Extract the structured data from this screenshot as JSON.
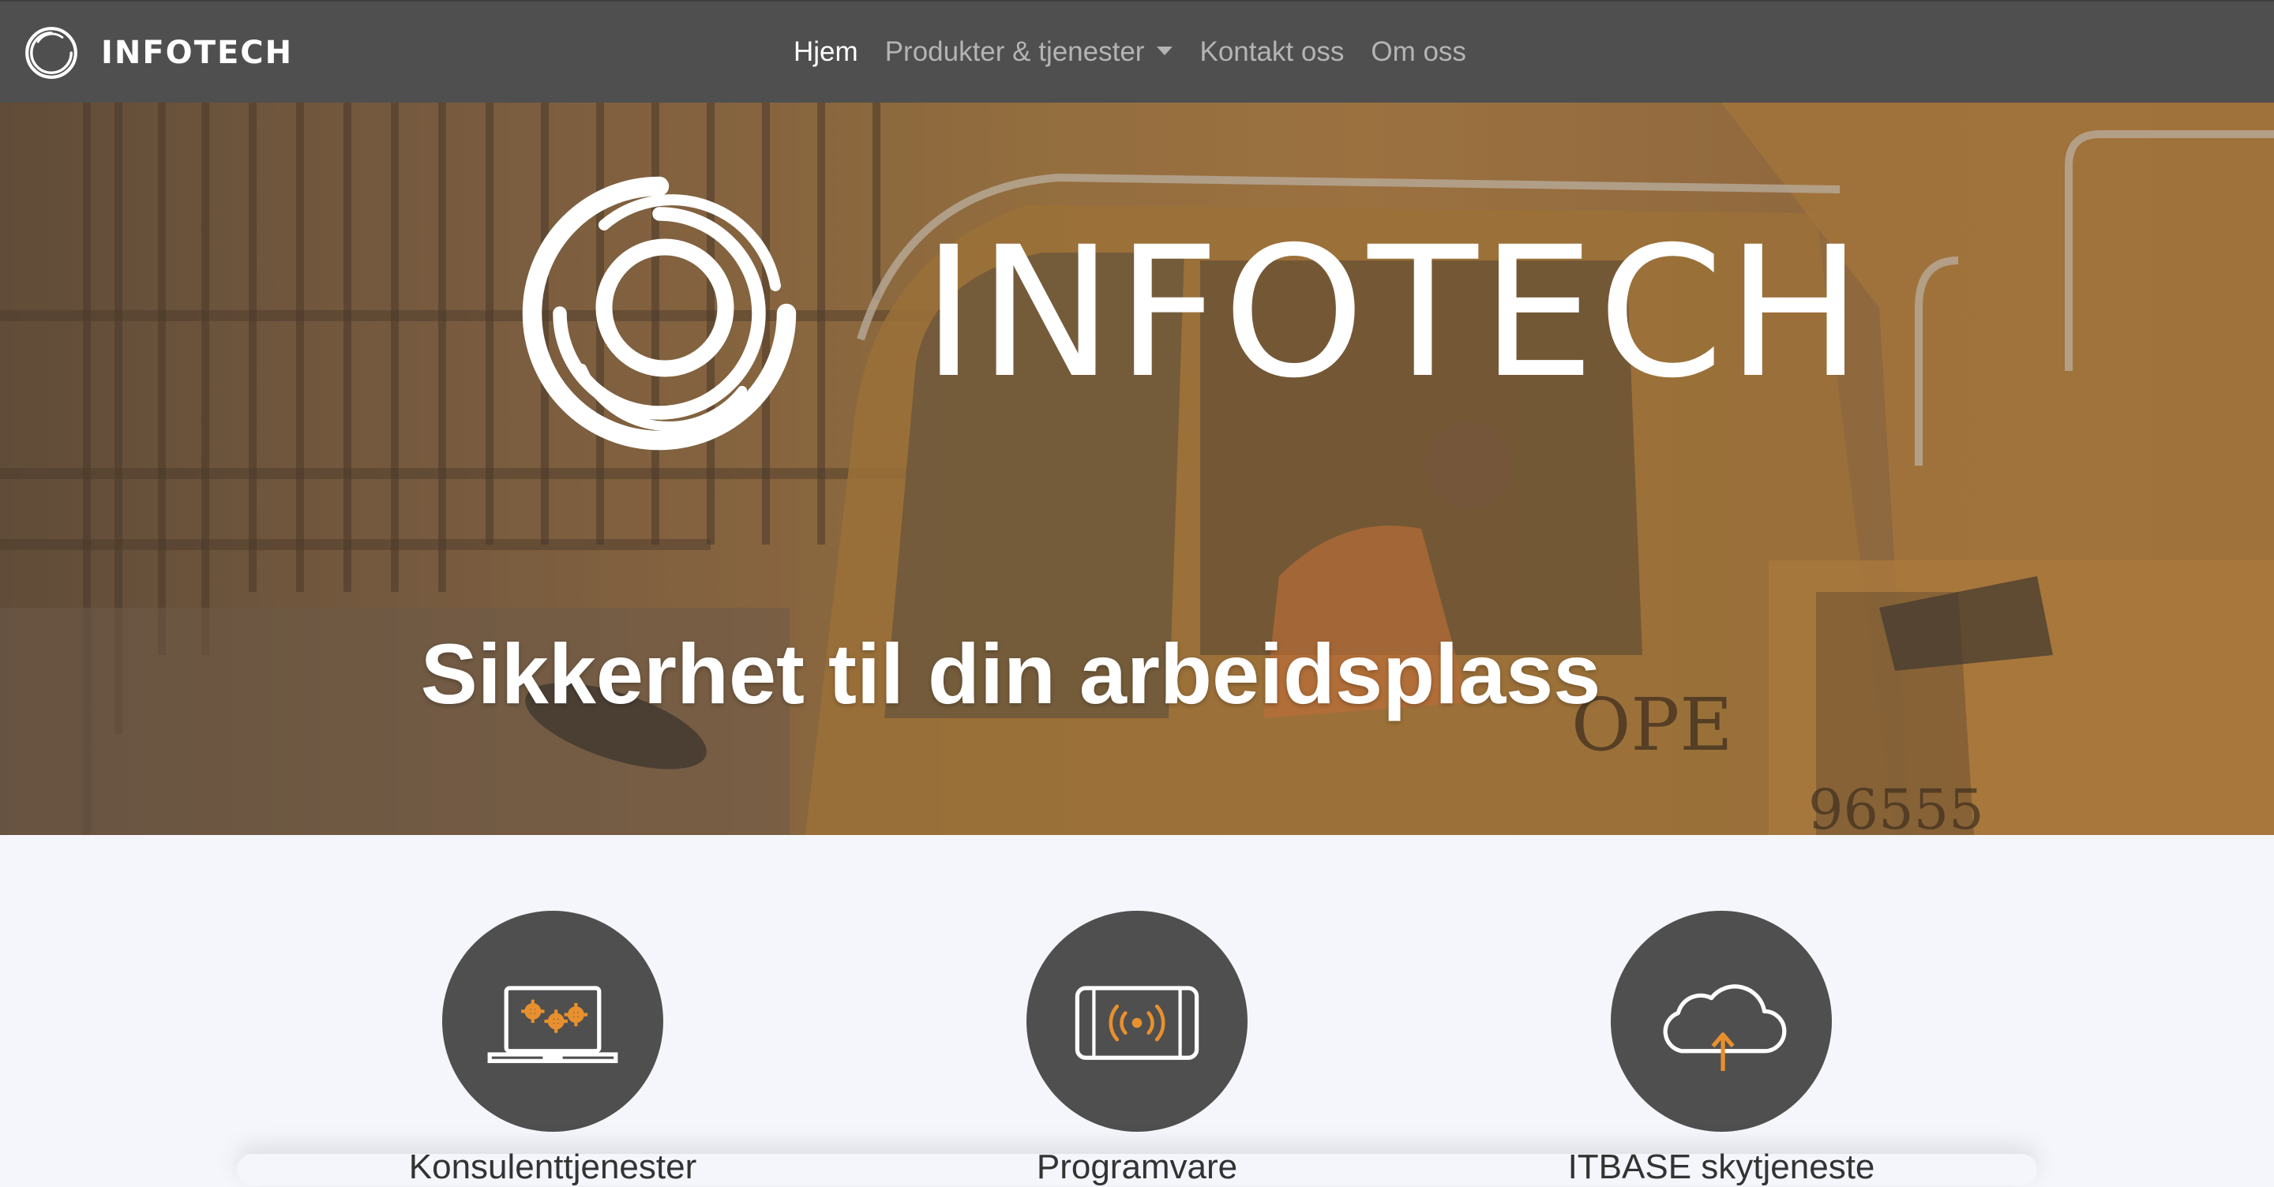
{
  "navbar": {
    "brand": "INFOTECH",
    "links": [
      {
        "label": "Hjem",
        "active": true
      },
      {
        "label": "Produkter & tjenester",
        "dropdown": true
      },
      {
        "label": "Kontakt oss"
      },
      {
        "label": "Om oss"
      }
    ]
  },
  "hero": {
    "title": "INFOTECH",
    "subtitle": "Sikkerhet til din arbeidsplass"
  },
  "features": [
    {
      "icon": "laptop-gears-icon",
      "label": "Konsulenttjenester"
    },
    {
      "icon": "tablet-signal-icon",
      "label": "Programvare"
    },
    {
      "icon": "cloud-upload-icon",
      "label": "ITBASE skytjeneste"
    }
  ],
  "colors": {
    "navbar": "#4f4f4f",
    "accent": "#e8902e",
    "page_bg": "#f4f6fb"
  }
}
